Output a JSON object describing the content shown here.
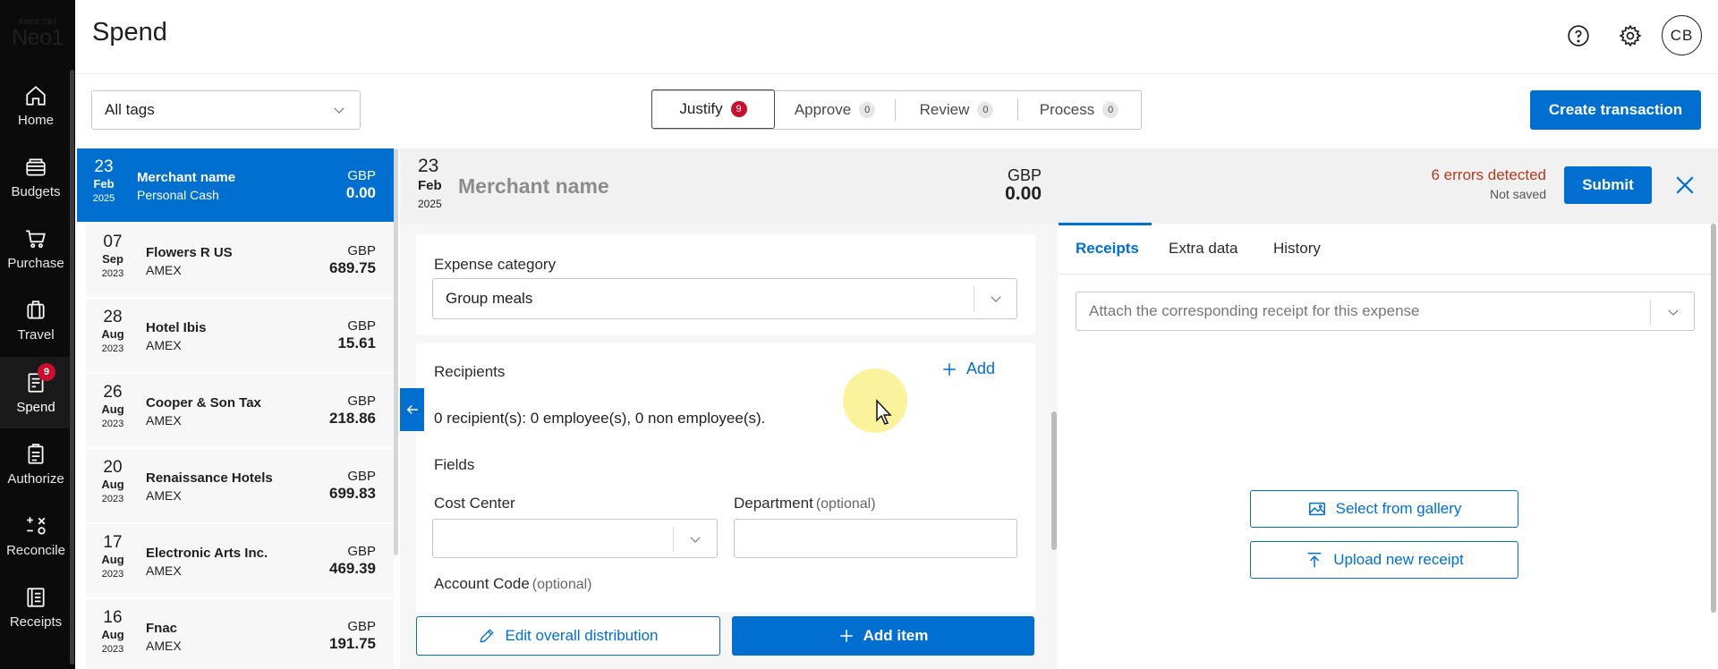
{
  "brand": {
    "small": "AMEX GBT",
    "name": "Neo1"
  },
  "sidebar": {
    "items": [
      {
        "label": "Home",
        "icon": "home-icon"
      },
      {
        "label": "Budgets",
        "icon": "wallet-icon"
      },
      {
        "label": "Purchase",
        "icon": "cart-icon"
      },
      {
        "label": "Travel",
        "icon": "luggage-icon"
      },
      {
        "label": "Spend",
        "icon": "receipt-doc-icon",
        "badge": "9"
      },
      {
        "label": "Authorize",
        "icon": "clipboard-check-icon"
      },
      {
        "label": "Reconcile",
        "icon": "reconcile-icon"
      },
      {
        "label": "Receipts",
        "icon": "receipts-icon"
      }
    ]
  },
  "header": {
    "title": "Spend",
    "avatar": "CB"
  },
  "toolbar": {
    "tags": "All tags",
    "tabs": [
      {
        "label": "Justify",
        "count": "9"
      },
      {
        "label": "Approve",
        "count": "0"
      },
      {
        "label": "Review",
        "count": "0"
      },
      {
        "label": "Process",
        "count": "0"
      }
    ],
    "create": "Create transaction"
  },
  "transactions": [
    {
      "day": "23",
      "month": "Feb",
      "year": "2025",
      "merchant": "Merchant name",
      "source": "Personal Cash",
      "currency": "GBP",
      "amount": "0.00"
    },
    {
      "day": "07",
      "month": "Sep",
      "year": "2023",
      "merchant": "Flowers R US",
      "source": "AMEX",
      "currency": "GBP",
      "amount": "689.75"
    },
    {
      "day": "28",
      "month": "Aug",
      "year": "2023",
      "merchant": "Hotel Ibis",
      "source": "AMEX",
      "currency": "GBP",
      "amount": "15.61"
    },
    {
      "day": "26",
      "month": "Aug",
      "year": "2023",
      "merchant": "Cooper & Son Tax",
      "source": "AMEX",
      "currency": "GBP",
      "amount": "218.86"
    },
    {
      "day": "20",
      "month": "Aug",
      "year": "2023",
      "merchant": "Renaissance Hotels",
      "source": "AMEX",
      "currency": "GBP",
      "amount": "699.83"
    },
    {
      "day": "17",
      "month": "Aug",
      "year": "2023",
      "merchant": "Electronic Arts Inc.",
      "source": "AMEX",
      "currency": "GBP",
      "amount": "469.39"
    },
    {
      "day": "16",
      "month": "Aug",
      "year": "2023",
      "merchant": "Fnac",
      "source": "AMEX",
      "currency": "GBP",
      "amount": "191.75"
    }
  ],
  "detail": {
    "day": "23",
    "month": "Feb",
    "year": "2025",
    "merchant": "Merchant name",
    "currency": "GBP",
    "amount": "0.00",
    "errors": "6 errors detected",
    "status": "Not saved",
    "submit": "Submit"
  },
  "form": {
    "expense_category_label": "Expense category",
    "expense_category_value": "Group meals",
    "recipients_label": "Recipients",
    "add_label": "Add",
    "recipients_summary": "0 recipient(s): 0 employee(s), 0 non employee(s).",
    "fields_label": "Fields",
    "cost_center_label": "Cost Center",
    "department_label": "Department",
    "optional": "(optional)",
    "account_code_label": "Account Code",
    "edit_distribution": "Edit overall distribution",
    "add_item": "Add item"
  },
  "receipts_panel": {
    "tabs": [
      "Receipts",
      "Extra data",
      "History"
    ],
    "attach_placeholder": "Attach the corresponding receipt for this expense",
    "gallery": "Select from gallery",
    "upload": "Upload new receipt"
  },
  "colors": {
    "accent": "#006fcf",
    "error": "#b4391c",
    "badge": "#c8102e",
    "sidebar": "#0b0b0b"
  }
}
